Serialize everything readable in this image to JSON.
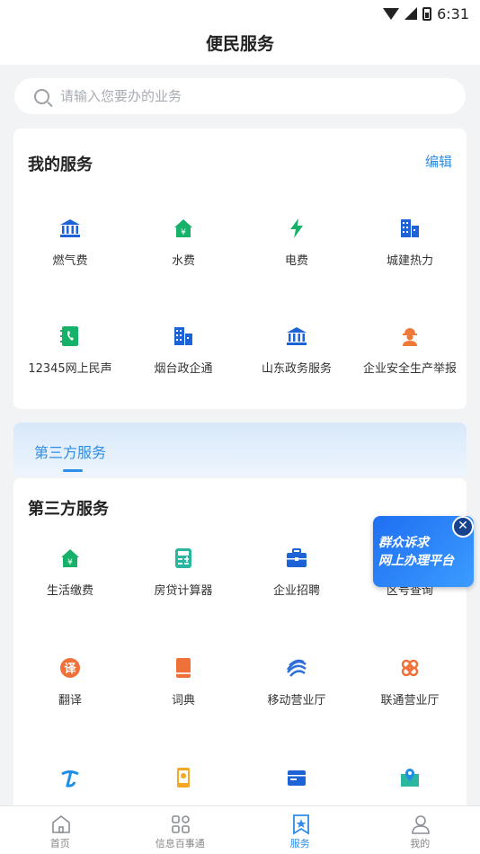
{
  "status_bar": {
    "time": "6:31"
  },
  "header": {
    "title": "便民服务"
  },
  "search": {
    "placeholder": "请输入您要办的业务"
  },
  "my_services": {
    "title": "我的服务",
    "edit_label": "编辑",
    "items": [
      {
        "label": "燃气费",
        "icon": "bank-icon",
        "color": "#1e63d6"
      },
      {
        "label": "水费",
        "icon": "house-yuan-icon",
        "color": "#17b26a"
      },
      {
        "label": "电费",
        "icon": "lightning-icon",
        "color": "#17b26a"
      },
      {
        "label": "城建热力",
        "icon": "buildings-icon",
        "color": "#1e63d6"
      },
      {
        "label": "12345网上民声",
        "icon": "phone-book-icon",
        "color": "#17b26a"
      },
      {
        "label": "烟台政企通",
        "icon": "buildings-icon",
        "color": "#1e63d6"
      },
      {
        "label": "山东政务服务",
        "icon": "bank-icon",
        "color": "#1e63d6"
      },
      {
        "label": "企业安全生产举报",
        "icon": "worker-icon",
        "color": "#f07a3a"
      }
    ]
  },
  "third_party_tab": {
    "label": "第三方服务"
  },
  "third_party": {
    "title": "第三方服务",
    "items": [
      {
        "label": "生活缴费",
        "icon": "house-yuan-icon",
        "color": "#17b26a"
      },
      {
        "label": "房贷计算器",
        "icon": "calculator-icon",
        "color": "#2bb6a0"
      },
      {
        "label": "企业招聘",
        "icon": "briefcase-icon",
        "color": "#1e63d6"
      },
      {
        "label": "区号查询",
        "icon": "search-icon",
        "color": "#1e63d6"
      },
      {
        "label": "翻译",
        "icon": "translate-icon",
        "color": "#f0703a"
      },
      {
        "label": "词典",
        "icon": "book-icon",
        "color": "#f0703a"
      },
      {
        "label": "移动营业厅",
        "icon": "china-mobile-icon",
        "color": "#2e6fd8"
      },
      {
        "label": "联通营业厅",
        "icon": "china-unicom-icon",
        "color": "#f0703a"
      },
      {
        "label": "",
        "icon": "china-telecom-icon",
        "color": "#1e8ee6"
      },
      {
        "label": "",
        "icon": "phone-location-icon",
        "color": "#f5a623"
      },
      {
        "label": "",
        "icon": "box-icon",
        "color": "#1e63d6"
      },
      {
        "label": "",
        "icon": "map-pin-icon",
        "color": "#2bb6a0"
      }
    ]
  },
  "float_banner": {
    "line1": "群众诉求",
    "line2": "网上办理平台"
  },
  "bottom_nav": {
    "items": [
      {
        "label": "首页",
        "icon": "home-icon"
      },
      {
        "label": "信息百事通",
        "icon": "grid-icon"
      },
      {
        "label": "服务",
        "icon": "bookmark-star-icon"
      },
      {
        "label": "我的",
        "icon": "user-icon"
      }
    ],
    "active_index": 2,
    "active_color": "#2e8de6"
  }
}
